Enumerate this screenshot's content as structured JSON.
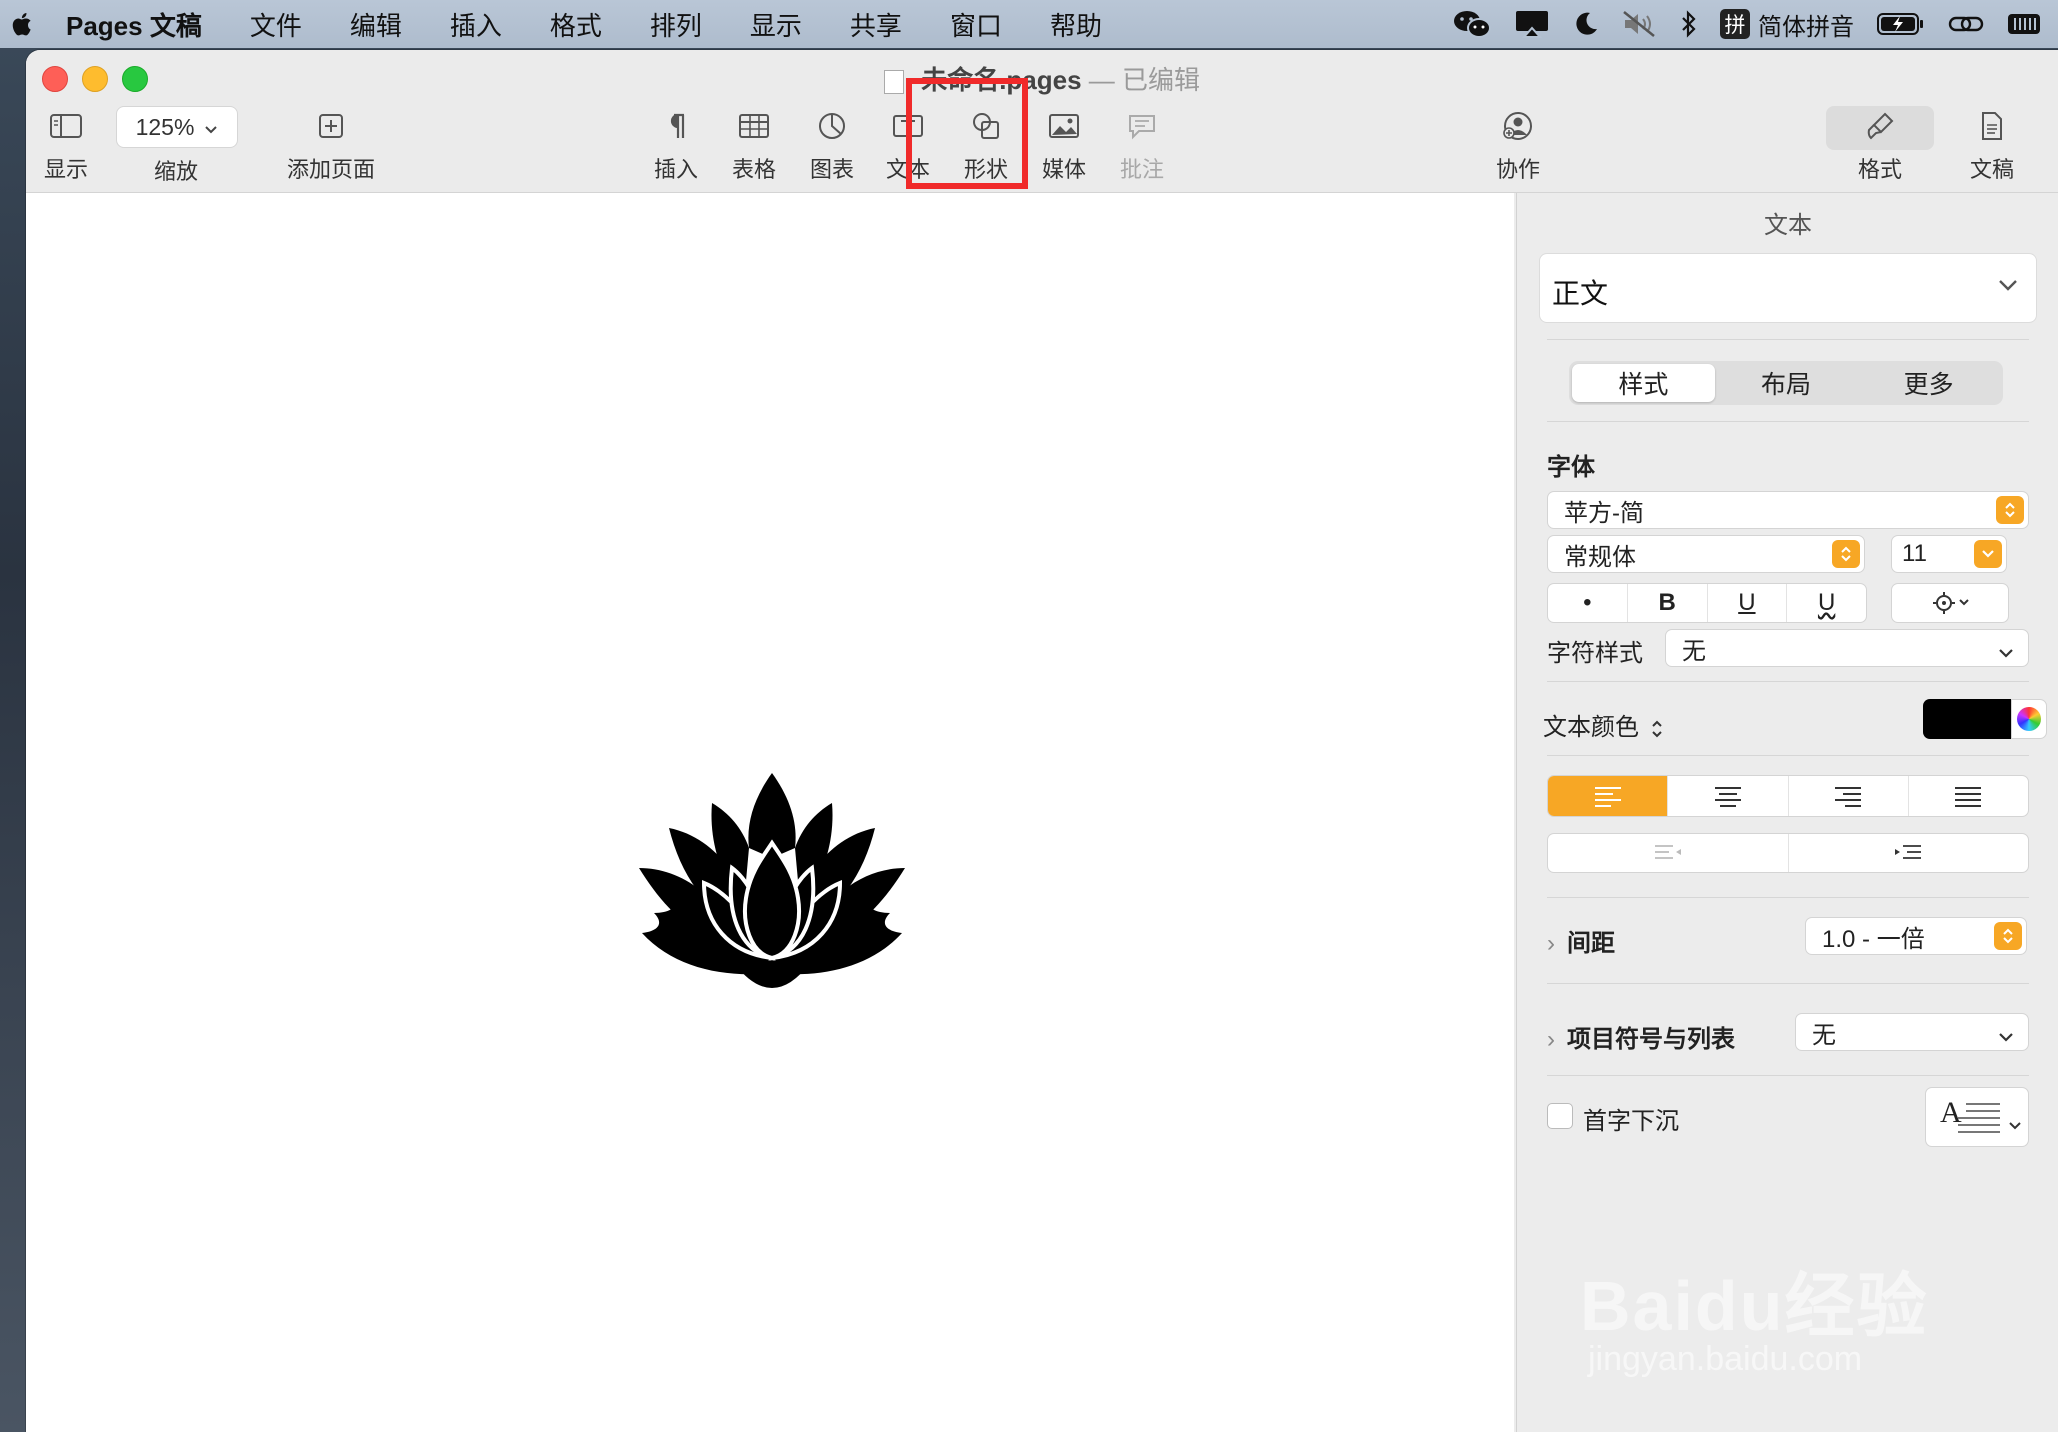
{
  "menubar": {
    "app_name": "Pages 文稿",
    "items": [
      "文件",
      "编辑",
      "插入",
      "格式",
      "排列",
      "显示",
      "共享",
      "窗口",
      "帮助"
    ],
    "input_method_badge": "拼",
    "input_method": "简体拼音"
  },
  "window": {
    "doc_name": "未命名.pages",
    "doc_sep": "—",
    "doc_state": "已编辑"
  },
  "toolbar": {
    "view_label": "显示",
    "zoom_value": "125%",
    "zoom_label": "缩放",
    "add_page_label": "添加页面",
    "insert_label": "插入",
    "table_label": "表格",
    "chart_label": "图表",
    "text_label": "文本",
    "shape_label": "形状",
    "media_label": "媒体",
    "comment_label": "批注",
    "collaborate_label": "协作",
    "format_label": "格式",
    "document_label": "文稿"
  },
  "inspector": {
    "title": "文本",
    "paragraph_style": "正文",
    "tabs": [
      "样式",
      "布局",
      "更多"
    ],
    "font_heading": "字体",
    "font_family": "苹方-简",
    "font_typeface": "常规体",
    "font_size": "11",
    "style_buttons": [
      "•",
      "B",
      "U",
      "U"
    ],
    "char_style_label": "字符样式",
    "char_style_value": "无",
    "text_color_label": "文本颜色",
    "text_color": "#000000",
    "spacing_label": "间距",
    "spacing_value": "1.0 - 一倍",
    "bullets_label": "项目符号与列表",
    "bullets_value": "无",
    "dropcap_label": "首字下沉",
    "dropcap_glyph": "A"
  },
  "colors": {
    "accent": "#f7a725",
    "highlight": "#f02a2a"
  },
  "watermark": {
    "brand": "Baidu经验",
    "url": "jingyan.baidu.com"
  }
}
